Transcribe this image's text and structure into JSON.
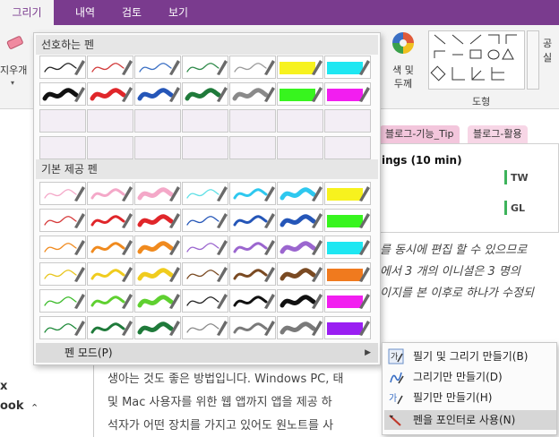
{
  "ribbon": {
    "tabs": [
      "그리기",
      "내역",
      "검토",
      "보기"
    ],
    "active_tab": 0,
    "eraser_label": "지우개",
    "color_label": [
      "색 및",
      "두께"
    ],
    "shapes_label": "도형",
    "right_cut": [
      "공",
      "실"
    ]
  },
  "gallery": {
    "favorites_title": "선호하는 펜",
    "builtin_title": "기본 제공 펜",
    "pen_mode_label": "펜 모드(P)",
    "favorite_pens": [
      [
        "#222222",
        "thin"
      ],
      [
        "#d23a3a",
        "thin"
      ],
      [
        "#3a6fc4",
        "thin"
      ],
      [
        "#2f8a4a",
        "thin"
      ],
      [
        "#9a9a9a",
        "thin"
      ],
      [
        "#f7f21e",
        "hl"
      ],
      [
        "#1ee7f2",
        "hl"
      ],
      [
        "#111111",
        "thick"
      ],
      [
        "#e0262a",
        "thick"
      ],
      [
        "#2556b8",
        "thick"
      ],
      [
        "#1f7a3a",
        "thick"
      ],
      [
        "#8a8a8a",
        "thick"
      ],
      [
        "#37f51e",
        "hl"
      ],
      [
        "#f21ef0",
        "hl"
      ]
    ],
    "builtin_pens": [
      [
        "#f4a8c8",
        "thin"
      ],
      [
        "#f4a8c8",
        "mid"
      ],
      [
        "#f4a8c8",
        "thick"
      ],
      [
        "#5fe0e6",
        "thin"
      ],
      [
        "#2ec8ef",
        "mid"
      ],
      [
        "#2ec8ef",
        "thick"
      ],
      [
        "#f7f21e",
        "hl"
      ],
      [
        "#d63a3a",
        "thin"
      ],
      [
        "#e0262a",
        "mid"
      ],
      [
        "#e0262a",
        "thick"
      ],
      [
        "#2556b8",
        "thin"
      ],
      [
        "#2556b8",
        "mid"
      ],
      [
        "#2556b8",
        "thick"
      ],
      [
        "#37f51e",
        "hl"
      ],
      [
        "#f08a1e",
        "thin"
      ],
      [
        "#f08a1e",
        "mid"
      ],
      [
        "#f08a1e",
        "thick"
      ],
      [
        "#9b66cf",
        "thin"
      ],
      [
        "#9b66cf",
        "mid"
      ],
      [
        "#9b66cf",
        "thick"
      ],
      [
        "#1ee7f2",
        "hl"
      ],
      [
        "#e8c51e",
        "thin"
      ],
      [
        "#f0cc1e",
        "mid"
      ],
      [
        "#f0cc1e",
        "thick"
      ],
      [
        "#7a4a22",
        "thin"
      ],
      [
        "#7a4a22",
        "mid"
      ],
      [
        "#7a4a22",
        "thick"
      ],
      [
        "#f07a1e",
        "hl"
      ],
      [
        "#3dbb2c",
        "thin"
      ],
      [
        "#5fd030",
        "mid"
      ],
      [
        "#5fd030",
        "thick"
      ],
      [
        "#222222",
        "thin"
      ],
      [
        "#111111",
        "mid"
      ],
      [
        "#111111",
        "thick"
      ],
      [
        "#f21ef0",
        "hl"
      ],
      [
        "#1f8a3a",
        "thin"
      ],
      [
        "#1f7a3a",
        "mid"
      ],
      [
        "#1f7a3a",
        "thick"
      ],
      [
        "#8a8a8a",
        "thin"
      ],
      [
        "#7a7a7a",
        "mid"
      ],
      [
        "#7a7a7a",
        "thick"
      ],
      [
        "#9a1ef2",
        "hl"
      ]
    ],
    "empty_rows": 2
  },
  "submenu": {
    "items": [
      {
        "label": "필기 및 그리기 만들기(B)",
        "icon": "pen-text-icon"
      },
      {
        "label": "그리기만 만들기(D)",
        "icon": "draw-icon"
      },
      {
        "label": "필기만 만들기(H)",
        "icon": "write-icon"
      },
      {
        "label": "펜을 포인터로 사용(N)",
        "icon": "pointer-pen-icon"
      }
    ],
    "highlighted": 3
  },
  "page": {
    "section_tabs": [
      "블로그-기능_Tip",
      "블로그-활용"
    ],
    "heading": "ings (10 min)",
    "tags": [
      "TW",
      "GL"
    ],
    "lines": [
      {
        "text": "를 동시에 편집 할 수 있으므로",
        "italic": true
      },
      {
        "text": "에서 3 개의 이니셜은 3 명의",
        "italic": true
      },
      {
        "text": "이지를 본 이후로 하나가 수정되",
        "italic": true
      },
      {
        "text": "생아는 것도 좋은 방법입니다. Windows PC, 태",
        "italic": false
      },
      {
        "text": "및 Mac 사용자를 위한 웹 앱까지 앱을 제공 하",
        "italic": false
      },
      {
        "text": "석자가 어떤 장치를 가지고 있어도 원노트를 사",
        "italic": false
      }
    ],
    "side_letters": [
      "x",
      "ook"
    ]
  },
  "colors": {
    "ribbon_purple": "#7a3b8e",
    "section_tab_pink": "#f3c6dc",
    "tag_green": "#3db35b"
  }
}
